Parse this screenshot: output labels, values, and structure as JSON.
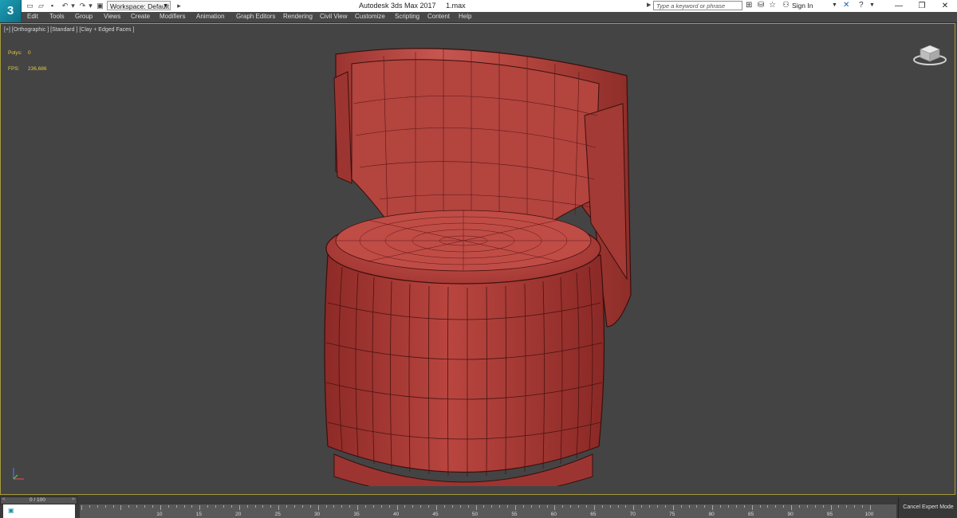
{
  "titlebar": {
    "app_logo": "3",
    "workspace": "Workspace: Default",
    "window_title": "Autodesk 3ds Max 2017     1.max",
    "search_placeholder": "Type a keyword or phrase",
    "signin": "Sign In"
  },
  "menu": {
    "items": [
      "Edit",
      "Tools",
      "Group",
      "Views",
      "Create",
      "Modifiers",
      "Animation",
      "Graph Editors",
      "Rendering",
      "Civil View",
      "Customize",
      "Scripting",
      "Content",
      "Help"
    ]
  },
  "viewport": {
    "label": "[+] [Orthographic ] [Standard ] [Clay + Edged Faces ]",
    "polys_label": "Polys:",
    "polys_value": "0",
    "fps_label": "FPS:",
    "fps_value": "236,686"
  },
  "timeline": {
    "frame_display": "0 / 100",
    "tick_labels": [
      "10",
      "15",
      "20",
      "25",
      "30",
      "35",
      "40",
      "45",
      "50",
      "55",
      "60",
      "65",
      "70",
      "75",
      "80",
      "85",
      "90",
      "95",
      "100"
    ]
  },
  "status": {
    "cancel_expert": "Cancel Expert Mode"
  },
  "colors": {
    "model": "#b8453f",
    "model_shadow": "#7a2422",
    "viewport_bg": "#444444",
    "active_border": "#a59a3a",
    "stat_text": "#e3c84a"
  }
}
